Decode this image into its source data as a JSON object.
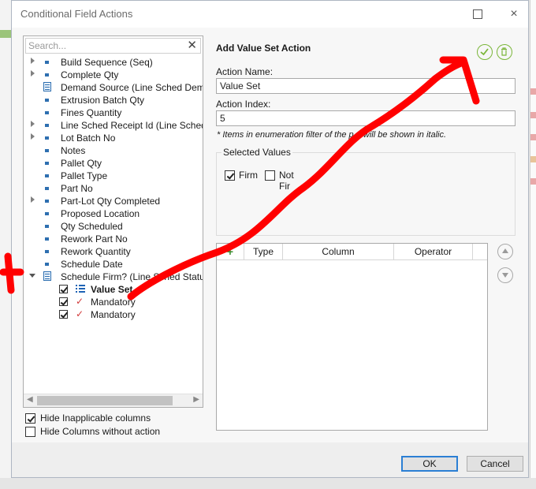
{
  "dialog": {
    "title": "Conditional Field Actions",
    "maximize": "",
    "close": "×"
  },
  "search": {
    "placeholder": "Search..."
  },
  "tree": {
    "items": [
      {
        "label": "Build Sequence (Seq)"
      },
      {
        "label": "Complete Qty"
      },
      {
        "label": "Demand Source (Line Sched Deman"
      },
      {
        "label": "Extrusion Batch Qty"
      },
      {
        "label": "Fines Quantity"
      },
      {
        "label": "Line Sched Receipt Id (Line Schedule"
      },
      {
        "label": "Lot Batch No"
      },
      {
        "label": "Notes"
      },
      {
        "label": "Pallet Qty"
      },
      {
        "label": "Pallet Type"
      },
      {
        "label": "Part No"
      },
      {
        "label": "Part-Lot Qty Completed"
      },
      {
        "label": "Proposed Location"
      },
      {
        "label": "Qty Scheduled"
      },
      {
        "label": "Rework Part No"
      },
      {
        "label": "Rework Quantity"
      },
      {
        "label": "Schedule Date"
      },
      {
        "label": "Schedule Firm? (Line Sched Status)"
      }
    ],
    "children": [
      {
        "label": "Value Set"
      },
      {
        "label": "Mandatory"
      },
      {
        "label": "Mandatory"
      }
    ]
  },
  "options": {
    "hide_inapplicable": "Hide Inapplicable columns",
    "hide_without_action": "Hide Columns without action"
  },
  "panel": {
    "title": "Add Value Set Action",
    "action_name_label": "Action Name:",
    "action_name_value": "Value Set",
    "action_index_label": "Action Index:",
    "action_index_value": "5",
    "note": "* Items in enumeration filter of the p    e will be shown in italic.",
    "selected_values_title": "Selected Values",
    "firm_label": "Firm",
    "not_firm_label": "Not Fir",
    "grid": {
      "add": "+",
      "col_type": "Type",
      "col_column": "Column",
      "col_operator": "Operator"
    }
  },
  "footer": {
    "ok": "OK",
    "cancel": "Cancel"
  },
  "colors": {
    "annotation": "#ff0000",
    "accent": "#2b7fd4",
    "ok_green": "#7bb63a"
  }
}
